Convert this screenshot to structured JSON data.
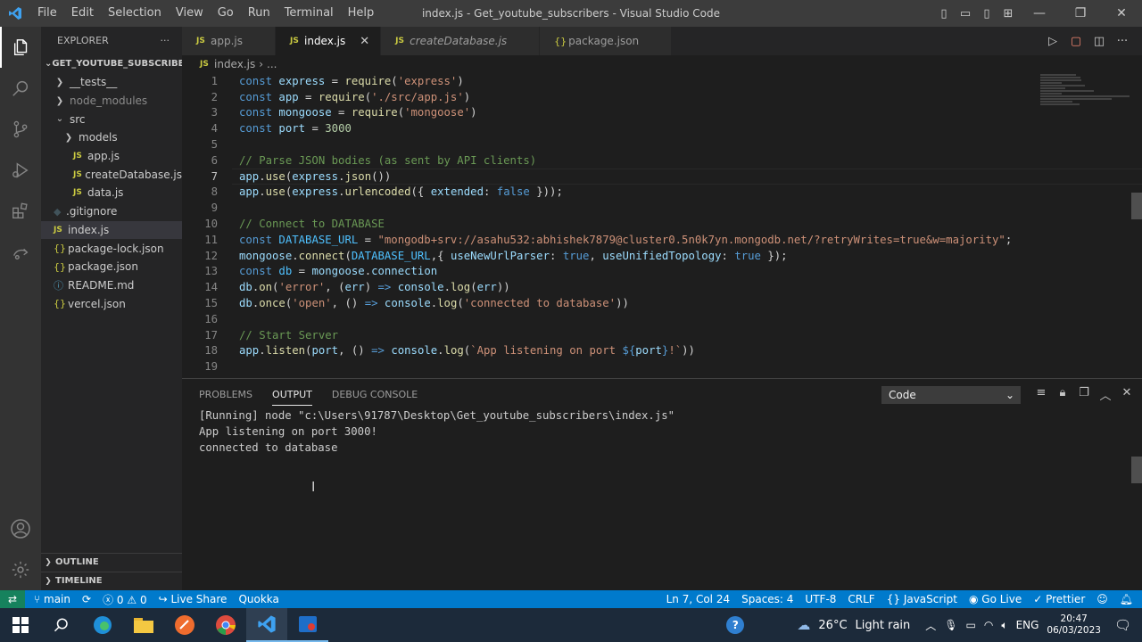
{
  "window": {
    "title": "index.js - Get_youtube_subscribers - Visual Studio Code",
    "menu": [
      "File",
      "Edit",
      "Selection",
      "View",
      "Go",
      "Run",
      "Terminal",
      "Help"
    ]
  },
  "sidebar": {
    "header": "EXPLORER",
    "more": "···",
    "root": "GET_YOUTUBE_SUBSCRIBE...",
    "items": [
      {
        "label": "__tests__",
        "kind": "folder",
        "expanded": false,
        "indent": 1
      },
      {
        "label": "node_modules",
        "kind": "folder",
        "expanded": false,
        "indent": 1,
        "dim": true
      },
      {
        "label": "src",
        "kind": "folder",
        "expanded": true,
        "indent": 1
      },
      {
        "label": "models",
        "kind": "folder",
        "expanded": false,
        "indent": 2
      },
      {
        "label": "app.js",
        "kind": "js",
        "indent": 2
      },
      {
        "label": "createDatabase.js",
        "kind": "js",
        "indent": 2
      },
      {
        "label": "data.js",
        "kind": "js",
        "indent": 2
      },
      {
        "label": ".gitignore",
        "kind": "git",
        "indent": 1
      },
      {
        "label": "index.js",
        "kind": "js",
        "indent": 1,
        "selected": true
      },
      {
        "label": "package-lock.json",
        "kind": "json",
        "indent": 1
      },
      {
        "label": "package.json",
        "kind": "json",
        "indent": 1
      },
      {
        "label": "README.md",
        "kind": "md",
        "indent": 1
      },
      {
        "label": "vercel.json",
        "kind": "json",
        "indent": 1
      }
    ],
    "outline": "OUTLINE",
    "timeline": "TIMELINE"
  },
  "tabs": [
    {
      "label": "app.js",
      "icon": "JS",
      "active": false,
      "italic": false
    },
    {
      "label": "index.js",
      "icon": "JS",
      "active": true,
      "italic": false,
      "close": "✕"
    },
    {
      "label": "createDatabase.js",
      "icon": "JS",
      "active": false,
      "italic": true
    },
    {
      "label": "package.json",
      "icon": "{}",
      "active": false,
      "italic": false
    }
  ],
  "breadcrumb": {
    "icon": "JS",
    "file": "index.js",
    "sep": "›",
    "more": "..."
  },
  "editor": {
    "current_line": 7,
    "lines": [
      [
        [
          "kw",
          "const "
        ],
        [
          "var",
          "express"
        ],
        [
          "pun",
          " = "
        ],
        [
          "fn",
          "require"
        ],
        [
          "pun",
          "("
        ],
        [
          "str",
          "'express'"
        ],
        [
          "pun",
          ")"
        ]
      ],
      [
        [
          "kw",
          "const "
        ],
        [
          "var",
          "app"
        ],
        [
          "pun",
          " = "
        ],
        [
          "fn",
          "require"
        ],
        [
          "pun",
          "("
        ],
        [
          "str",
          "'./src/app.js'"
        ],
        [
          "pun",
          ")"
        ]
      ],
      [
        [
          "kw",
          "const "
        ],
        [
          "var",
          "mongoose"
        ],
        [
          "pun",
          " = "
        ],
        [
          "fn",
          "require"
        ],
        [
          "pun",
          "("
        ],
        [
          "str",
          "'mongoose'"
        ],
        [
          "pun",
          ")"
        ]
      ],
      [
        [
          "kw",
          "const "
        ],
        [
          "var",
          "port"
        ],
        [
          "pun",
          " = "
        ],
        [
          "num",
          "3000"
        ]
      ],
      [],
      [
        [
          "cmt",
          "// Parse JSON bodies (as sent by API clients)"
        ]
      ],
      [
        [
          "var",
          "app"
        ],
        [
          "pun",
          "."
        ],
        [
          "fn",
          "use"
        ],
        [
          "pun",
          "("
        ],
        [
          "var",
          "express"
        ],
        [
          "pun",
          "."
        ],
        [
          "fn",
          "json"
        ],
        [
          "pun",
          "())"
        ]
      ],
      [
        [
          "var",
          "app"
        ],
        [
          "pun",
          "."
        ],
        [
          "fn",
          "use"
        ],
        [
          "pun",
          "("
        ],
        [
          "var",
          "express"
        ],
        [
          "pun",
          "."
        ],
        [
          "fn",
          "urlencoded"
        ],
        [
          "pun",
          "({ "
        ],
        [
          "var",
          "extended"
        ],
        [
          "pun",
          ": "
        ],
        [
          "kw",
          "false"
        ],
        [
          "pun",
          " }));"
        ]
      ],
      [],
      [
        [
          "cmt",
          "// Connect to DATABASE"
        ]
      ],
      [
        [
          "kw",
          "const "
        ],
        [
          "cst",
          "DATABASE_URL"
        ],
        [
          "pun",
          " = "
        ],
        [
          "str",
          "\"mongodb+srv://asahu532:abhishek7879@cluster0.5n0k7yn.mongodb.net/?retryWrites=true&w=majority\""
        ],
        [
          "pun",
          ";"
        ]
      ],
      [
        [
          "var",
          "mongoose"
        ],
        [
          "pun",
          "."
        ],
        [
          "fn",
          "connect"
        ],
        [
          "pun",
          "("
        ],
        [
          "cst",
          "DATABASE_URL"
        ],
        [
          "pun",
          ",{ "
        ],
        [
          "var",
          "useNewUrlParser"
        ],
        [
          "pun",
          ": "
        ],
        [
          "kw",
          "true"
        ],
        [
          "pun",
          ", "
        ],
        [
          "var",
          "useUnifiedTopology"
        ],
        [
          "pun",
          ": "
        ],
        [
          "kw",
          "true"
        ],
        [
          "pun",
          " });"
        ]
      ],
      [
        [
          "kw",
          "const "
        ],
        [
          "cst",
          "db"
        ],
        [
          "pun",
          " = "
        ],
        [
          "var",
          "mongoose"
        ],
        [
          "pun",
          "."
        ],
        [
          "var",
          "connection"
        ]
      ],
      [
        [
          "var",
          "db"
        ],
        [
          "pun",
          "."
        ],
        [
          "fn",
          "on"
        ],
        [
          "pun",
          "("
        ],
        [
          "str",
          "'error'"
        ],
        [
          "pun",
          ", ("
        ],
        [
          "var",
          "err"
        ],
        [
          "pun",
          ") "
        ],
        [
          "kw",
          "=>"
        ],
        [
          "pun",
          " "
        ],
        [
          "var",
          "console"
        ],
        [
          "pun",
          "."
        ],
        [
          "fn",
          "log"
        ],
        [
          "pun",
          "("
        ],
        [
          "var",
          "err"
        ],
        [
          "pun",
          "))"
        ]
      ],
      [
        [
          "var",
          "db"
        ],
        [
          "pun",
          "."
        ],
        [
          "fn",
          "once"
        ],
        [
          "pun",
          "("
        ],
        [
          "str",
          "'open'"
        ],
        [
          "pun",
          ", () "
        ],
        [
          "kw",
          "=>"
        ],
        [
          "pun",
          " "
        ],
        [
          "var",
          "console"
        ],
        [
          "pun",
          "."
        ],
        [
          "fn",
          "log"
        ],
        [
          "pun",
          "("
        ],
        [
          "str",
          "'connected to database'"
        ],
        [
          "pun",
          "))"
        ]
      ],
      [],
      [
        [
          "cmt",
          "// Start Server"
        ]
      ],
      [
        [
          "var",
          "app"
        ],
        [
          "pun",
          "."
        ],
        [
          "fn",
          "listen"
        ],
        [
          "pun",
          "("
        ],
        [
          "var",
          "port"
        ],
        [
          "pun",
          ", () "
        ],
        [
          "kw",
          "=>"
        ],
        [
          "pun",
          " "
        ],
        [
          "var",
          "console"
        ],
        [
          "pun",
          "."
        ],
        [
          "fn",
          "log"
        ],
        [
          "pun",
          "("
        ],
        [
          "tpl",
          "`App listening on port "
        ],
        [
          "inter",
          "${"
        ],
        [
          "var",
          "port"
        ],
        [
          "inter",
          "}"
        ],
        [
          "tpl",
          "!`"
        ],
        [
          "pun",
          "))"
        ]
      ],
      []
    ]
  },
  "panel": {
    "tabs": [
      "PROBLEMS",
      "OUTPUT",
      "DEBUG CONSOLE"
    ],
    "active_tab": "OUTPUT",
    "channel": "Code",
    "output": [
      "[Running] node \"c:\\Users\\91787\\Desktop\\Get_youtube_subscribers\\index.js\"",
      "App listening on port 3000!",
      "connected to database"
    ]
  },
  "statusbar": {
    "branch": "main",
    "errors": "0",
    "warnings": "0",
    "liveshare": "Live Share",
    "quokka": "Quokka",
    "position": "Ln 7, Col 24",
    "spaces": "Spaces: 4",
    "encoding": "UTF-8",
    "eol": "CRLF",
    "language": "JavaScript",
    "golive": "Go Live",
    "prettier": "Prettier"
  },
  "taskbar": {
    "weather_temp": "26°C",
    "weather_desc": "Light rain",
    "lang": "ENG",
    "time": "20:47",
    "date": "06/03/2023"
  },
  "colors": {
    "accent": "#007acc",
    "remote": "#16825d",
    "taskbar": "#1c2a3a"
  }
}
